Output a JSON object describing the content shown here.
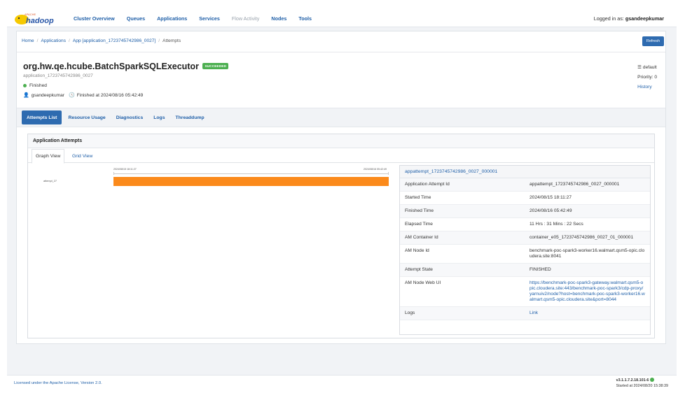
{
  "nav": {
    "logo_top": "APACHE",
    "logo_main": "hadoop",
    "links": [
      "Cluster Overview",
      "Queues",
      "Applications",
      "Services",
      "Flow Activity",
      "Nodes",
      "Tools"
    ],
    "disabled_link": "Flow Activity",
    "user_prefix": "Logged in as:",
    "user_name": "gsandeepkumar"
  },
  "breadcrumb": [
    "Home",
    "Applications",
    "App [application_1723745742986_0027]",
    "Attempts"
  ],
  "refresh_label": "Refresh",
  "app": {
    "name": "org.hw.qe.hcube.BatchSparkSQLExecutor",
    "badge": "SUCCEEDED",
    "id": "application_1723745742986_0027",
    "state": "Finished",
    "user": "gsandeepkumar",
    "finished": "Finished at 2024/08/16 05:42:49",
    "queue": "default",
    "priority": "Priority: 0",
    "history": "History"
  },
  "tabs": [
    "Attempts List",
    "Resource Usage",
    "Diagnostics",
    "Logs",
    "Threaddump"
  ],
  "panel": {
    "title": "Application Attempts",
    "view_tabs": [
      "Graph View",
      "Grid View"
    ]
  },
  "graph": {
    "start_tick": "2024/08/15 18:11:27",
    "end_tick": "2024/08/16 05:42:49",
    "row_label": "attempt_27"
  },
  "details": {
    "header": "appattempt_1723745742986_0027_000001",
    "rows": [
      {
        "k": "Application Attempt Id",
        "v": "appattempt_1723745742986_0027_000001"
      },
      {
        "k": "Started Time",
        "v": "2024/08/15 18:11:27"
      },
      {
        "k": "Finished Time",
        "v": "2024/08/16 05:42:49"
      },
      {
        "k": "Elapsed Time",
        "v": "11 Hrs : 31 Mins : 22 Secs"
      },
      {
        "k": "AM Container Id",
        "v": "container_e05_1723745742986_0027_01_000001"
      },
      {
        "k": "AM Node Id",
        "v": "benchmark-poc-spark3-worker16.walmart.qsm5-opic.cloudera.site:8041"
      },
      {
        "k": "Attempt State",
        "v": "FINISHED"
      },
      {
        "k": "AM Node Web UI",
        "v": "https://benchmark-poc-spark3-gateway.walmart.qsm5-opic.cloudera.site:443/benchmark-poc-spark3/cdp-proxy/yarnuiv2/node?host=benchmark-poc-spark3-worker16.walmart.qsm5-opic.cloudera.site&port=8044"
      },
      {
        "k": "Logs",
        "v": "Link"
      }
    ]
  },
  "footer": {
    "license": "Licensed under the Apache License, Version 2.0.",
    "version": "v3.1.1.7.2.18.101-6",
    "started": "Started at 2024/08/20 15:38:39"
  }
}
